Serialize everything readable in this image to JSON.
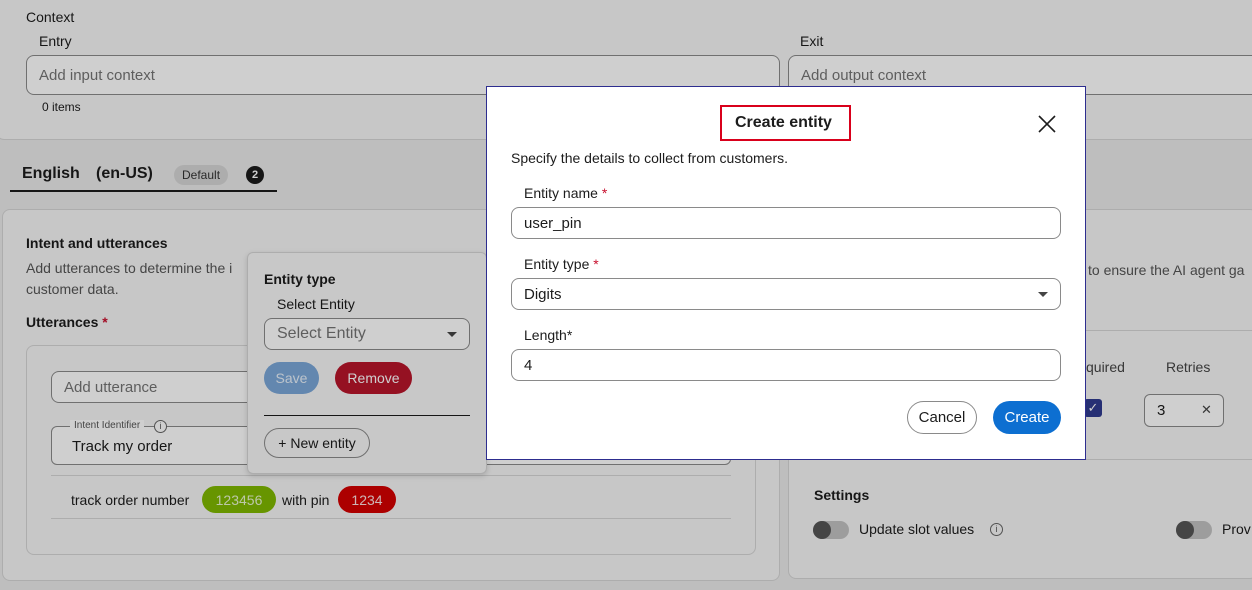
{
  "context": {
    "title": "Context",
    "entry_label": "Entry",
    "entry_placeholder": "Add input context",
    "entry_count": "0 items",
    "exit_label": "Exit",
    "exit_placeholder": "Add output context"
  },
  "language_tab": {
    "label": "English",
    "code": "(en-US)",
    "badge": "Default",
    "count": "2"
  },
  "intent": {
    "title": "Intent and utterances",
    "desc_line1": "Add utterances to determine the i",
    "desc_line2": "customer data.",
    "utterances_label": "Utterances",
    "add_placeholder": "Add utterance",
    "intent_identifier_label": "Intent Identifier",
    "intent_identifier_value": "Track my order",
    "utterance_prefix": "track order number",
    "entity1_value": "123456",
    "utterance_mid": "with pin",
    "entity2_value": "1234"
  },
  "entity_popover": {
    "title": "Entity type",
    "select_label": "Select Entity",
    "select_placeholder": "Select Entity",
    "save_label": "Save",
    "remove_label": "Remove",
    "new_entity_label": "+ New entity"
  },
  "right_panel": {
    "desc_fragment": "to ensure the AI agent ga",
    "required_header": "quired",
    "retries_header": "Retries",
    "retries_value": "3",
    "settings_title": "Settings",
    "update_slot_label": "Update slot values",
    "prov_label": "Prov"
  },
  "modal": {
    "title": "Create entity",
    "subtitle": "Specify the details to collect from customers.",
    "name_label": "Entity name",
    "name_value": "user_pin",
    "type_label": "Entity type",
    "type_value": "Digits",
    "length_label": "Length*",
    "length_value": "4",
    "cancel_label": "Cancel",
    "create_label": "Create"
  },
  "colors": {
    "primary": "#0d6fd1",
    "danger": "#c8102e",
    "entity_green": "#7fb800",
    "entity_red": "#d40000",
    "highlight_border": "#d9001b"
  }
}
